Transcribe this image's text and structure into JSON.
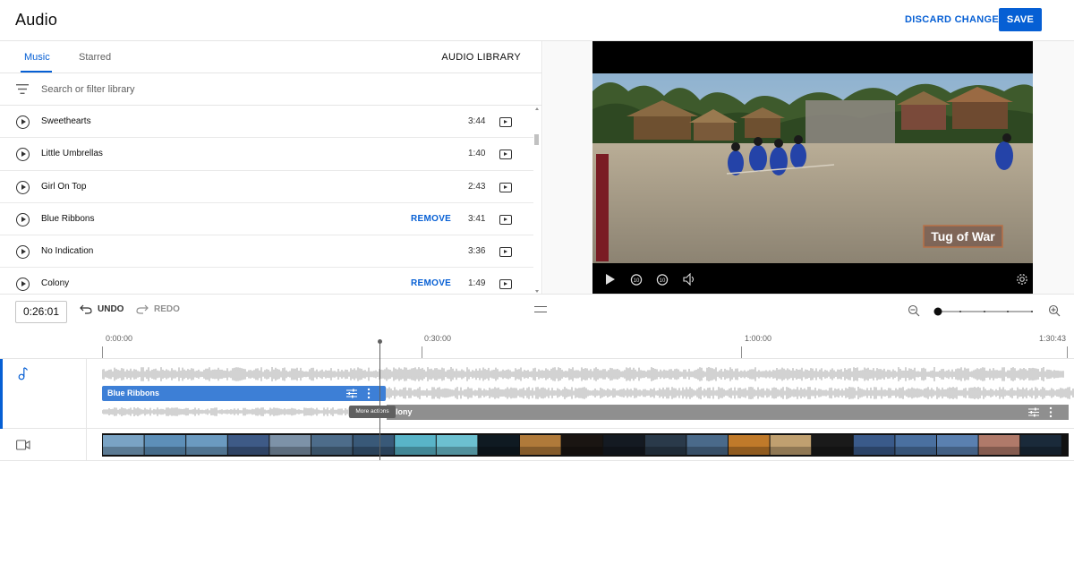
{
  "header": {
    "title": "Audio",
    "discard_label": "DISCARD CHANGES",
    "save_label": "SAVE"
  },
  "library": {
    "tabs": [
      {
        "label": "Music",
        "active": true
      },
      {
        "label": "Starred",
        "active": false
      }
    ],
    "audio_library_label": "AUDIO LIBRARY",
    "search": {
      "placeholder": "Search or filter library",
      "value": ""
    },
    "tracks": [
      {
        "name": "Sweethearts",
        "duration": "3:44",
        "remove": ""
      },
      {
        "name": "Little Umbrellas",
        "duration": "1:40",
        "remove": ""
      },
      {
        "name": "Girl On Top",
        "duration": "2:43",
        "remove": ""
      },
      {
        "name": "Blue Ribbons",
        "duration": "3:41",
        "remove": "REMOVE"
      },
      {
        "name": "No Indication",
        "duration": "3:36",
        "remove": ""
      },
      {
        "name": "Colony",
        "duration": "1:49",
        "remove": "REMOVE"
      }
    ]
  },
  "preview": {
    "overlay_text": "Tug of War"
  },
  "timeline": {
    "timecode": "0:26:01",
    "undo_label": "UNDO",
    "redo_label": "REDO",
    "ruler_ticks": [
      "0:00:00",
      "0:30:00",
      "1:00:00",
      "1:30:43"
    ],
    "clips": [
      {
        "name": "Blue Ribbons"
      },
      {
        "name": "Colony",
        "visible_label": "lony"
      }
    ],
    "tooltip": "More actions"
  },
  "colors": {
    "accent": "#065fd4",
    "clip_blue": "#3d7fd6",
    "clip_grey": "#8f8f8f",
    "waveform": "#c6c6c6"
  }
}
